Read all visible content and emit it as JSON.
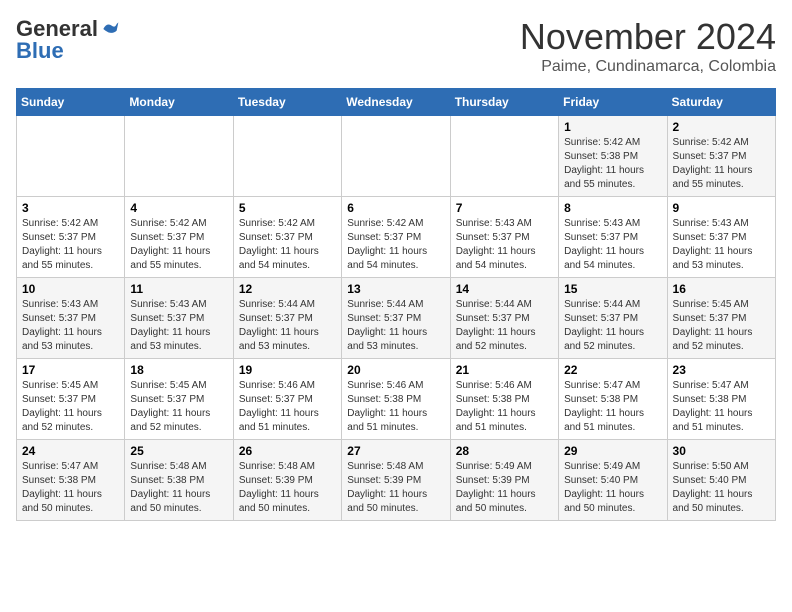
{
  "header": {
    "logo_general": "General",
    "logo_blue": "Blue",
    "month_title": "November 2024",
    "location": "Paime, Cundinamarca, Colombia"
  },
  "days_of_week": [
    "Sunday",
    "Monday",
    "Tuesday",
    "Wednesday",
    "Thursday",
    "Friday",
    "Saturday"
  ],
  "weeks": [
    [
      {
        "day": "",
        "info": ""
      },
      {
        "day": "",
        "info": ""
      },
      {
        "day": "",
        "info": ""
      },
      {
        "day": "",
        "info": ""
      },
      {
        "day": "",
        "info": ""
      },
      {
        "day": "1",
        "info": "Sunrise: 5:42 AM\nSunset: 5:38 PM\nDaylight: 11 hours and 55 minutes."
      },
      {
        "day": "2",
        "info": "Sunrise: 5:42 AM\nSunset: 5:37 PM\nDaylight: 11 hours and 55 minutes."
      }
    ],
    [
      {
        "day": "3",
        "info": "Sunrise: 5:42 AM\nSunset: 5:37 PM\nDaylight: 11 hours and 55 minutes."
      },
      {
        "day": "4",
        "info": "Sunrise: 5:42 AM\nSunset: 5:37 PM\nDaylight: 11 hours and 55 minutes."
      },
      {
        "day": "5",
        "info": "Sunrise: 5:42 AM\nSunset: 5:37 PM\nDaylight: 11 hours and 54 minutes."
      },
      {
        "day": "6",
        "info": "Sunrise: 5:42 AM\nSunset: 5:37 PM\nDaylight: 11 hours and 54 minutes."
      },
      {
        "day": "7",
        "info": "Sunrise: 5:43 AM\nSunset: 5:37 PM\nDaylight: 11 hours and 54 minutes."
      },
      {
        "day": "8",
        "info": "Sunrise: 5:43 AM\nSunset: 5:37 PM\nDaylight: 11 hours and 54 minutes."
      },
      {
        "day": "9",
        "info": "Sunrise: 5:43 AM\nSunset: 5:37 PM\nDaylight: 11 hours and 53 minutes."
      }
    ],
    [
      {
        "day": "10",
        "info": "Sunrise: 5:43 AM\nSunset: 5:37 PM\nDaylight: 11 hours and 53 minutes."
      },
      {
        "day": "11",
        "info": "Sunrise: 5:43 AM\nSunset: 5:37 PM\nDaylight: 11 hours and 53 minutes."
      },
      {
        "day": "12",
        "info": "Sunrise: 5:44 AM\nSunset: 5:37 PM\nDaylight: 11 hours and 53 minutes."
      },
      {
        "day": "13",
        "info": "Sunrise: 5:44 AM\nSunset: 5:37 PM\nDaylight: 11 hours and 53 minutes."
      },
      {
        "day": "14",
        "info": "Sunrise: 5:44 AM\nSunset: 5:37 PM\nDaylight: 11 hours and 52 minutes."
      },
      {
        "day": "15",
        "info": "Sunrise: 5:44 AM\nSunset: 5:37 PM\nDaylight: 11 hours and 52 minutes."
      },
      {
        "day": "16",
        "info": "Sunrise: 5:45 AM\nSunset: 5:37 PM\nDaylight: 11 hours and 52 minutes."
      }
    ],
    [
      {
        "day": "17",
        "info": "Sunrise: 5:45 AM\nSunset: 5:37 PM\nDaylight: 11 hours and 52 minutes."
      },
      {
        "day": "18",
        "info": "Sunrise: 5:45 AM\nSunset: 5:37 PM\nDaylight: 11 hours and 52 minutes."
      },
      {
        "day": "19",
        "info": "Sunrise: 5:46 AM\nSunset: 5:37 PM\nDaylight: 11 hours and 51 minutes."
      },
      {
        "day": "20",
        "info": "Sunrise: 5:46 AM\nSunset: 5:38 PM\nDaylight: 11 hours and 51 minutes."
      },
      {
        "day": "21",
        "info": "Sunrise: 5:46 AM\nSunset: 5:38 PM\nDaylight: 11 hours and 51 minutes."
      },
      {
        "day": "22",
        "info": "Sunrise: 5:47 AM\nSunset: 5:38 PM\nDaylight: 11 hours and 51 minutes."
      },
      {
        "day": "23",
        "info": "Sunrise: 5:47 AM\nSunset: 5:38 PM\nDaylight: 11 hours and 51 minutes."
      }
    ],
    [
      {
        "day": "24",
        "info": "Sunrise: 5:47 AM\nSunset: 5:38 PM\nDaylight: 11 hours and 50 minutes."
      },
      {
        "day": "25",
        "info": "Sunrise: 5:48 AM\nSunset: 5:38 PM\nDaylight: 11 hours and 50 minutes."
      },
      {
        "day": "26",
        "info": "Sunrise: 5:48 AM\nSunset: 5:39 PM\nDaylight: 11 hours and 50 minutes."
      },
      {
        "day": "27",
        "info": "Sunrise: 5:48 AM\nSunset: 5:39 PM\nDaylight: 11 hours and 50 minutes."
      },
      {
        "day": "28",
        "info": "Sunrise: 5:49 AM\nSunset: 5:39 PM\nDaylight: 11 hours and 50 minutes."
      },
      {
        "day": "29",
        "info": "Sunrise: 5:49 AM\nSunset: 5:40 PM\nDaylight: 11 hours and 50 minutes."
      },
      {
        "day": "30",
        "info": "Sunrise: 5:50 AM\nSunset: 5:40 PM\nDaylight: 11 hours and 50 minutes."
      }
    ]
  ]
}
